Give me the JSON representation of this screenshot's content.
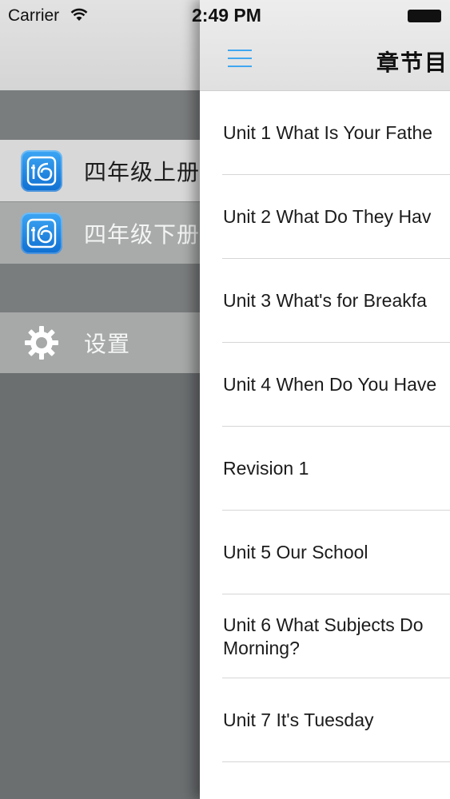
{
  "status_bar": {
    "carrier": "Carrier",
    "time": "2:49 PM"
  },
  "drawer": {
    "books": [
      {
        "label": "四年级上册",
        "selected": true
      },
      {
        "label": "四年级下册",
        "selected": false
      }
    ],
    "settings_label": "设置"
  },
  "nav": {
    "title": "章节目",
    "menu_icon": "hamburger-menu-icon"
  },
  "chapters": [
    {
      "title": "Unit 1 What Is Your Fathe"
    },
    {
      "title": "Unit 2 What Do They Hav"
    },
    {
      "title": "Unit 3 What's for Breakfa"
    },
    {
      "title": "Unit 4 When Do You Have"
    },
    {
      "title": "Revision 1"
    },
    {
      "title": "Unit 5 Our School"
    },
    {
      "title": "Unit 6 What Subjects Do Morning?"
    },
    {
      "title": "Unit 7 It's Tuesday"
    }
  ],
  "colors": {
    "accent": "#3fa7f0",
    "drawer_background": "#6b6f70",
    "book_icon": "#1a84e0"
  }
}
